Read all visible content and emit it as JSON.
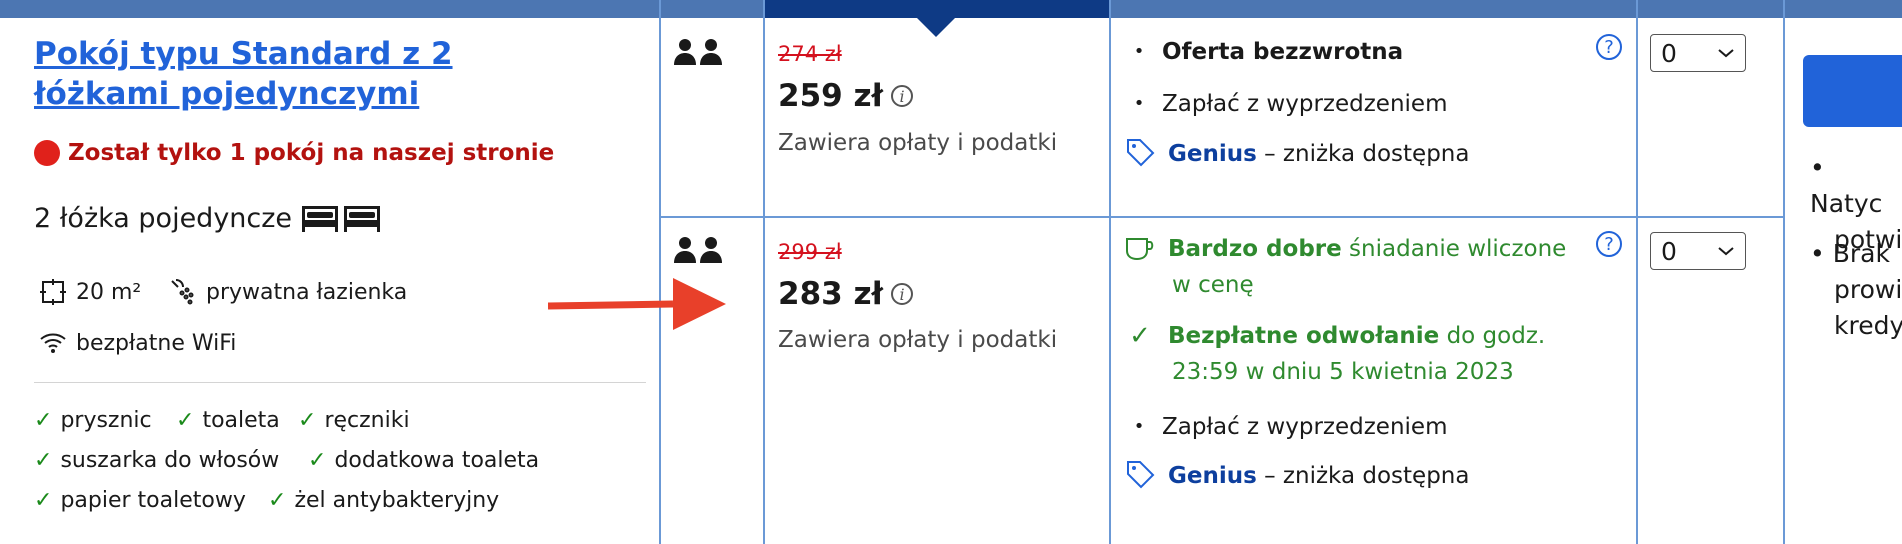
{
  "room": {
    "title": "Pokój typu Standard z 2 łóżkami pojedynczymi",
    "scarcity": "Został tylko 1 pokój na naszej stronie",
    "beds": "2 łóżka pojedyncze",
    "size": "20 m²",
    "bathroom": "prywatna łazienka",
    "wifi": "bezpłatne WiFi",
    "amenities": [
      "prysznic",
      "toaleta",
      "ręczniki",
      "suszarka do włosów",
      "dodatkowa toaleta",
      "papier toaletowy",
      "żel antybakteryjny"
    ]
  },
  "offers": [
    {
      "old_price": "274 zł",
      "price": "259 zł",
      "taxes_note": "Zawiera opłaty i podatki",
      "conditions": {
        "nonrefundable": "Oferta bezzwrotna",
        "pay_ahead": "Zapłać z wyprzedzeniem",
        "genius": "Genius",
        "genius_suffix": "– zniżka dostępna"
      },
      "qty": "0"
    },
    {
      "old_price": "299 zł",
      "price": "283 zł",
      "taxes_note": "Zawiera opłaty i podatki",
      "conditions": {
        "breakfast_strong": "Bardzo dobre",
        "breakfast_rest": "śniadanie wliczone",
        "breakfast_line2": "w cenę",
        "cancel_strong": "Bezpłatne odwołanie",
        "cancel_rest": "do godz.",
        "cancel_line2": "23:59 w dniu 5 kwietnia 2023",
        "pay_ahead": "Zapłać z wyprzedzeniem",
        "genius": "Genius",
        "genius_suffix": "– zniżka dostępna"
      },
      "qty": "0"
    }
  ],
  "right_panel": {
    "items": [
      [
        "Natyc",
        "potwi"
      ],
      [
        "Brak",
        "prowi",
        "kredy"
      ]
    ]
  },
  "colors": {
    "header": "#4c76b2",
    "header_selected": "#0e3a85",
    "link": "#2163d9",
    "alert": "#b3120f",
    "arrow": "#e8402a"
  }
}
